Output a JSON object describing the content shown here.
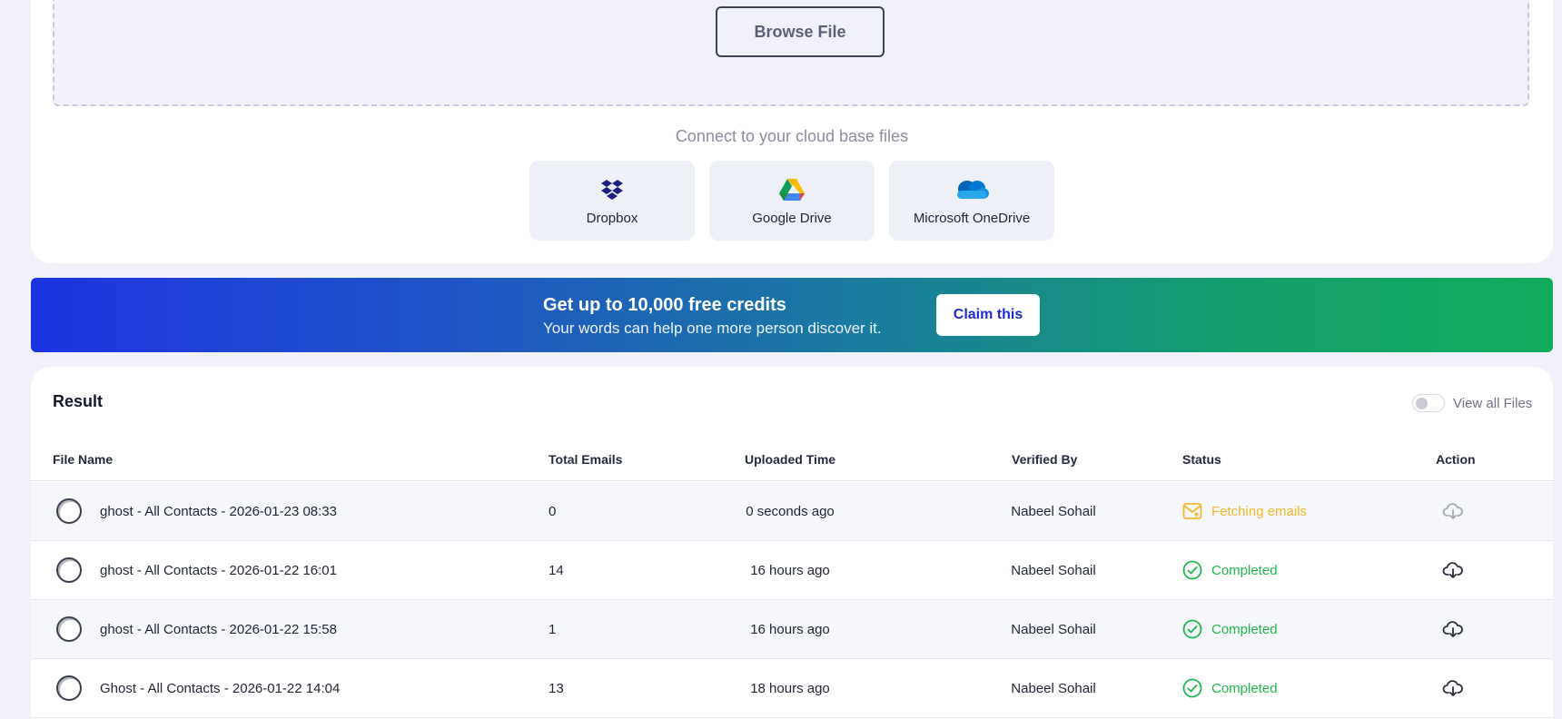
{
  "upload": {
    "browse_label": "Browse File",
    "cloud_heading": "Connect to your cloud base files",
    "providers": [
      {
        "label": "Dropbox",
        "icon": "dropbox-icon"
      },
      {
        "label": "Google Drive",
        "icon": "google-drive-icon"
      },
      {
        "label": "Microsoft OneDrive",
        "icon": "onedrive-icon"
      }
    ]
  },
  "promo": {
    "title": "Get up to 10,000 free credits",
    "subtitle": "Your words can help one more person discover it.",
    "button_label": "Claim this"
  },
  "result": {
    "title": "Result",
    "toggle_label": "View all Files",
    "columns": [
      "File Name",
      "Total Emails",
      "Uploaded Time",
      "Verified By",
      "Status",
      "Action"
    ],
    "rows": [
      {
        "file_name": "ghost - All Contacts - 2026-01-23 08:33",
        "total_emails": "0",
        "uploaded": "0 seconds ago",
        "verified_by": "Nabeel Sohail",
        "status": "Fetching emails",
        "status_type": "fetching"
      },
      {
        "file_name": "ghost - All Contacts - 2026-01-22 16:01",
        "total_emails": "14",
        "uploaded": "16 hours ago",
        "verified_by": "Nabeel Sohail",
        "status": "Completed",
        "status_type": "completed"
      },
      {
        "file_name": "ghost - All Contacts - 2026-01-22 15:58",
        "total_emails": "1",
        "uploaded": "16 hours ago",
        "verified_by": "Nabeel Sohail",
        "status": "Completed",
        "status_type": "completed"
      },
      {
        "file_name": "Ghost - All Contacts - 2026-01-22 14:04",
        "total_emails": "13",
        "uploaded": "18 hours ago",
        "verified_by": "Nabeel Sohail",
        "status": "Completed",
        "status_type": "completed"
      }
    ]
  },
  "colors": {
    "fetching": "#f2b928",
    "completed": "#1fb84f",
    "accent": "#1c2bd8"
  }
}
